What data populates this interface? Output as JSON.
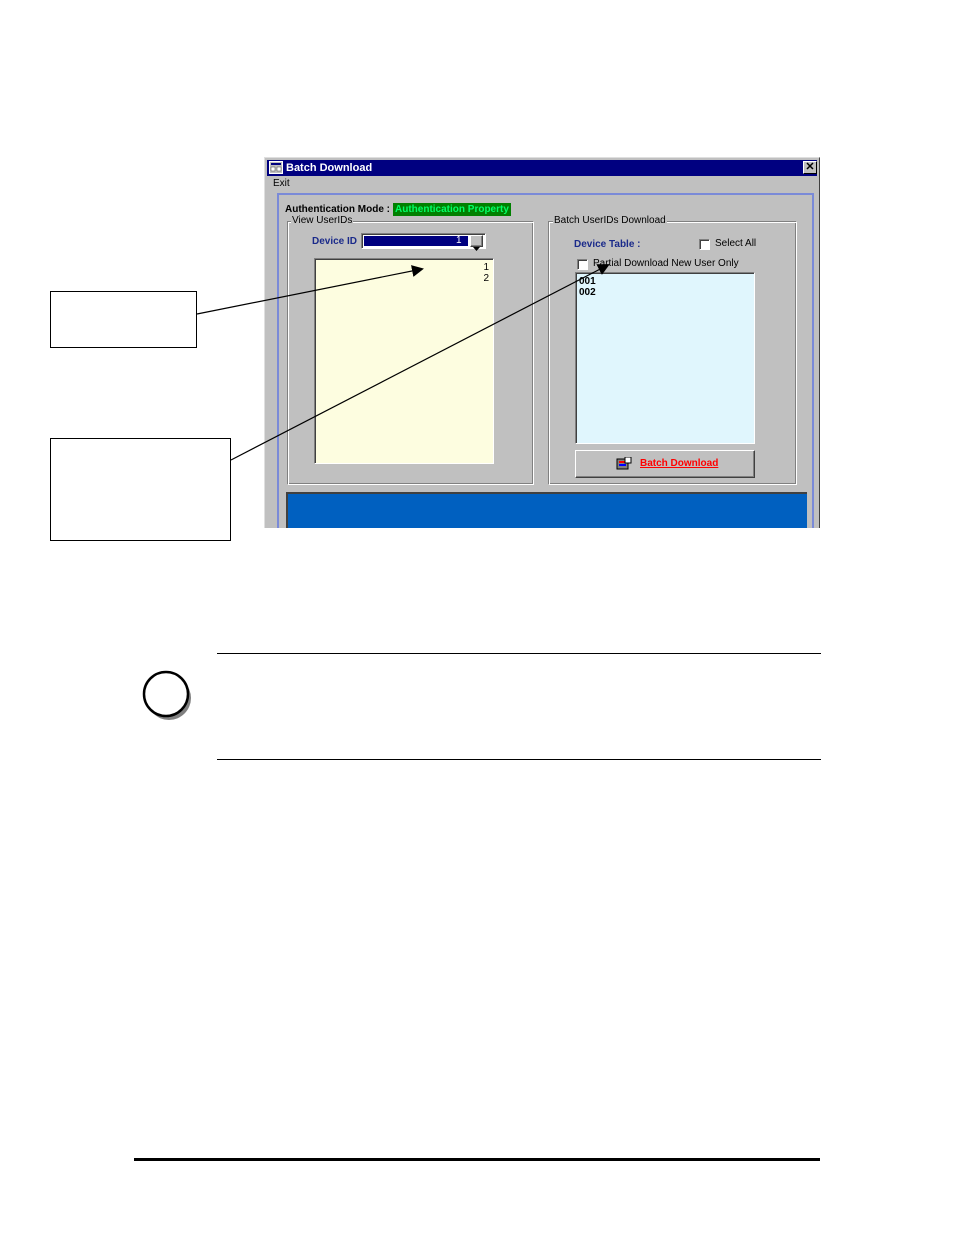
{
  "window": {
    "title": "Batch Download",
    "close_glyph": "✕",
    "menu": {
      "exit_label": "Exit"
    }
  },
  "auth": {
    "label": "Authentication Mode :",
    "value": "Authentication Property"
  },
  "view_group": {
    "title": "View UserIDs",
    "device_id_label": "Device ID",
    "device_id_value": "1",
    "user_ids": [
      "1",
      "2"
    ]
  },
  "batch_group": {
    "title": "Batch UserIDs Download",
    "device_table_label": "Device Table :",
    "select_all_label": "Select All",
    "partial_label": "Partial Download New User Only",
    "devices": [
      "001",
      "002"
    ],
    "button_label": "Batch Download"
  },
  "colors": {
    "title_bar": "#000080",
    "auth_value_bg": "#008000",
    "auth_value_fg": "#00ff66",
    "user_list_bg": "#fdfde0",
    "device_list_bg": "#e0f6fd",
    "status_panel": "#0060c0",
    "button_text": "#ff0000"
  },
  "icons": {
    "title": "app-window-icon",
    "button": "download-icon",
    "note": "info-circle-icon"
  }
}
